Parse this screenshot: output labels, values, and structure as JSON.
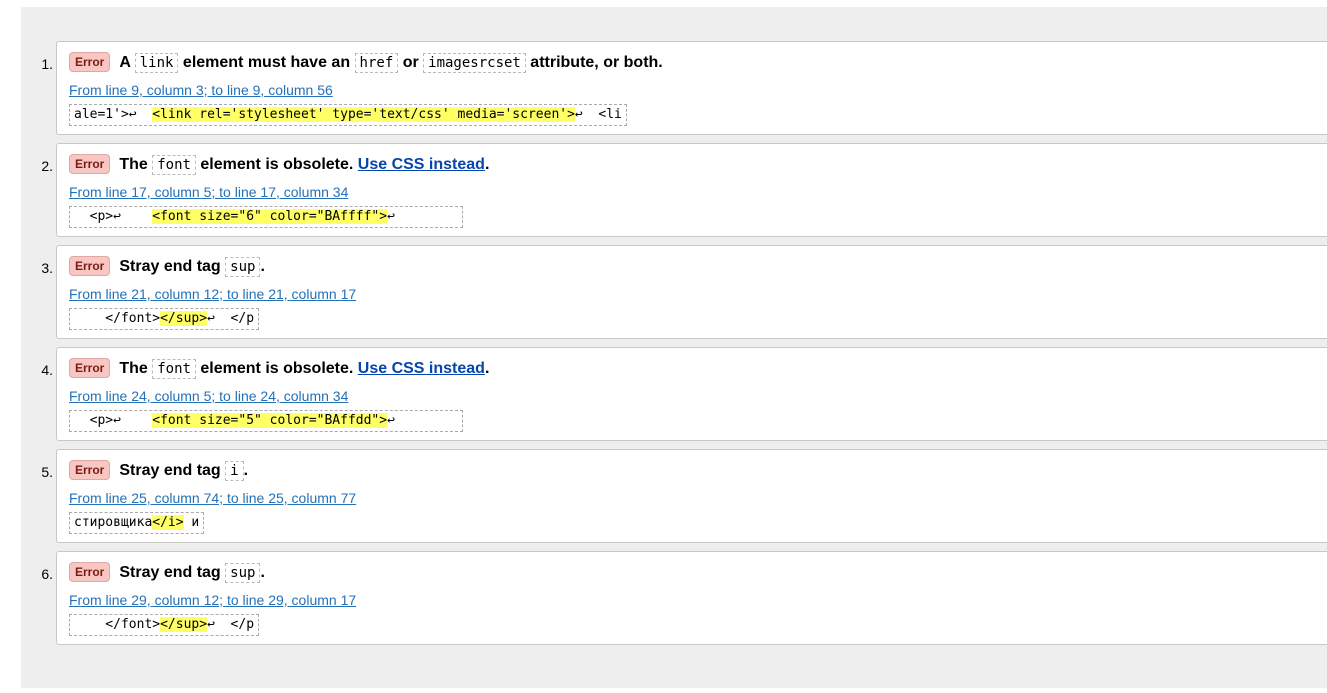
{
  "messages": [
    {
      "num": "1.",
      "badge": "Error",
      "t1": "A ",
      "c1": "link",
      "t2": " element must have an ",
      "c2": "href",
      "t3": " or ",
      "c3": "imagesrcset",
      "t4": " attribute, or both.",
      "location": "From line 9, column 3; to line 9, column 56",
      "pre": "ale=1'>↩  ",
      "mark": "<link rel='stylesheet' type='text/css' media='screen'>",
      "post": "↩  <li"
    },
    {
      "num": "2.",
      "badge": "Error",
      "t1": "The ",
      "c1": "font",
      "t2": " element is obsolete. ",
      "link": "Use CSS instead",
      "t3": ".",
      "location": "From line 17, column 5; to line 17, column 34",
      "pre": "  <p>↩    ",
      "mark": "<font size=\"6\" color=\"BAffff\">",
      "post": "↩        "
    },
    {
      "num": "3.",
      "badge": "Error",
      "t1": "Stray end tag ",
      "c1": "sup",
      "t2": ".",
      "location": "From line 21, column 12; to line 21, column 17",
      "pre": "    </font>",
      "mark": "</sup>",
      "post": "↩  </p"
    },
    {
      "num": "4.",
      "badge": "Error",
      "t1": "The ",
      "c1": "font",
      "t2": " element is obsolete. ",
      "link": "Use CSS instead",
      "t3": ".",
      "location": "From line 24, column 5; to line 24, column 34",
      "pre": "  <p>↩    ",
      "mark": "<font size=\"5\" color=\"BAffdd\">",
      "post": "↩        "
    },
    {
      "num": "5.",
      "badge": "Error",
      "t1": "Stray end tag ",
      "c1": "i",
      "t2": ".",
      "location": "From line 25, column 74; to line 25, column 77",
      "pre": "стировщика",
      "mark": "</i>",
      "post": " и"
    },
    {
      "num": "6.",
      "badge": "Error",
      "t1": "Stray end tag ",
      "c1": "sup",
      "t2": ".",
      "location": "From line 29, column 12; to line 29, column 17",
      "pre": "    </font>",
      "mark": "</sup>",
      "post": "↩  </p"
    }
  ]
}
